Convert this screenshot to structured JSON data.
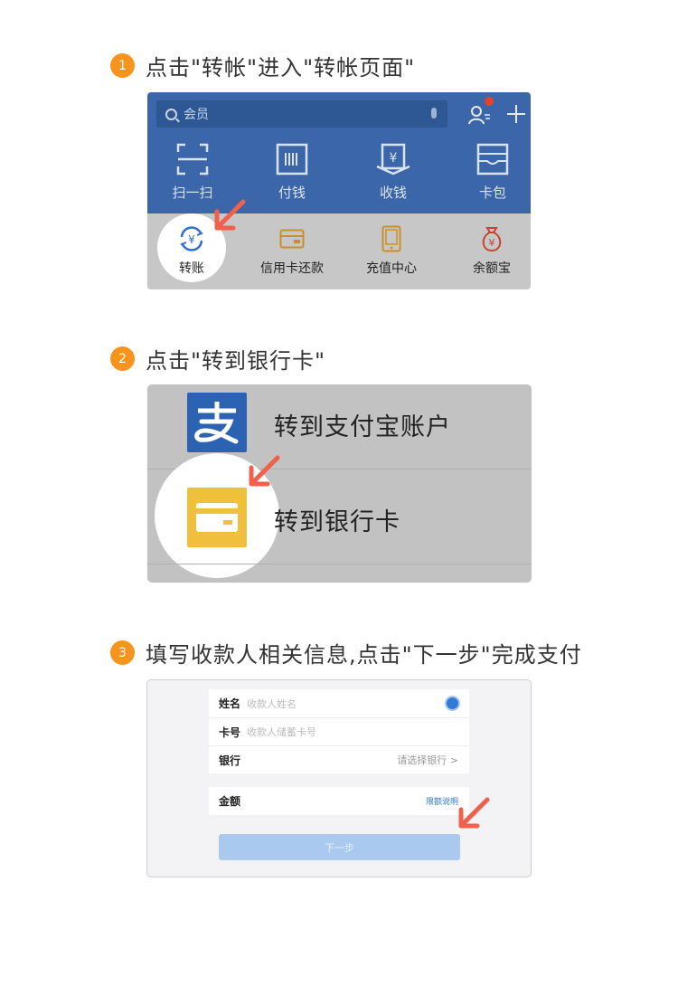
{
  "colors": {
    "badge": "#f7941d",
    "top_bar": "#3b66a9",
    "arrow": "#f0604a",
    "alipay_blue": "#2b62b1",
    "bank_yellow": "#f0c03d",
    "link_blue": "#2f7bd6"
  },
  "steps": [
    {
      "number": "1",
      "text": "点击\"转帐\"进入\"转帐页面\""
    },
    {
      "number": "2",
      "text": "点击\"转到银行卡\""
    },
    {
      "number": "3",
      "text": "填写收款人相关信息,点击\"下一步\"完成支付"
    }
  ],
  "panel1": {
    "search_placeholder": "会员",
    "top_buttons": [
      {
        "label": "扫一扫",
        "icon": "scan-icon"
      },
      {
        "label": "付钱",
        "icon": "barcode-icon"
      },
      {
        "label": "收钱",
        "icon": "receive-money-icon"
      },
      {
        "label": "卡包",
        "icon": "wallet-icon"
      }
    ],
    "bottom_buttons": [
      {
        "label": "转账",
        "icon": "transfer-icon"
      },
      {
        "label": "信用卡还款",
        "icon": "credit-card-icon"
      },
      {
        "label": "充值中心",
        "icon": "phone-icon"
      },
      {
        "label": "余额宝",
        "icon": "money-bag-icon"
      }
    ]
  },
  "panel2": {
    "options": [
      {
        "label": "转到支付宝账户",
        "icon": "alipay-icon"
      },
      {
        "label": "转到银行卡",
        "icon": "bank-card-icon"
      }
    ]
  },
  "panel3": {
    "name_label": "姓名",
    "name_placeholder": "收款人姓名",
    "card_label": "卡号",
    "card_placeholder": "收款人储蓄卡号",
    "bank_label": "银行",
    "bank_select": "请选择银行 >",
    "amount_label": "金额",
    "limit_link": "限额说明",
    "next_button": "下一步"
  }
}
